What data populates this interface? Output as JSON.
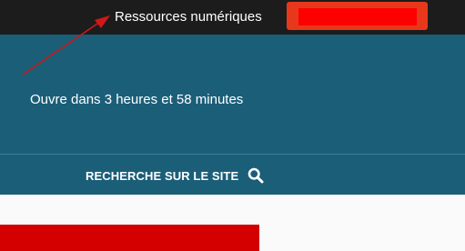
{
  "header": {
    "resources_link": "Ressources numériques",
    "button_color": "#e8381b",
    "button_inner_color": "#ff0000",
    "background": "#1c1c1c"
  },
  "hero": {
    "hours_text": "Ouvre dans 3 heures et 58 minutes",
    "background": "#1b5e78"
  },
  "search": {
    "label": "RECHERCHE SUR LE SITE",
    "icon": "search-icon"
  },
  "annotation": {
    "arrow_color": "#d01818",
    "banner_color": "#d40000"
  }
}
